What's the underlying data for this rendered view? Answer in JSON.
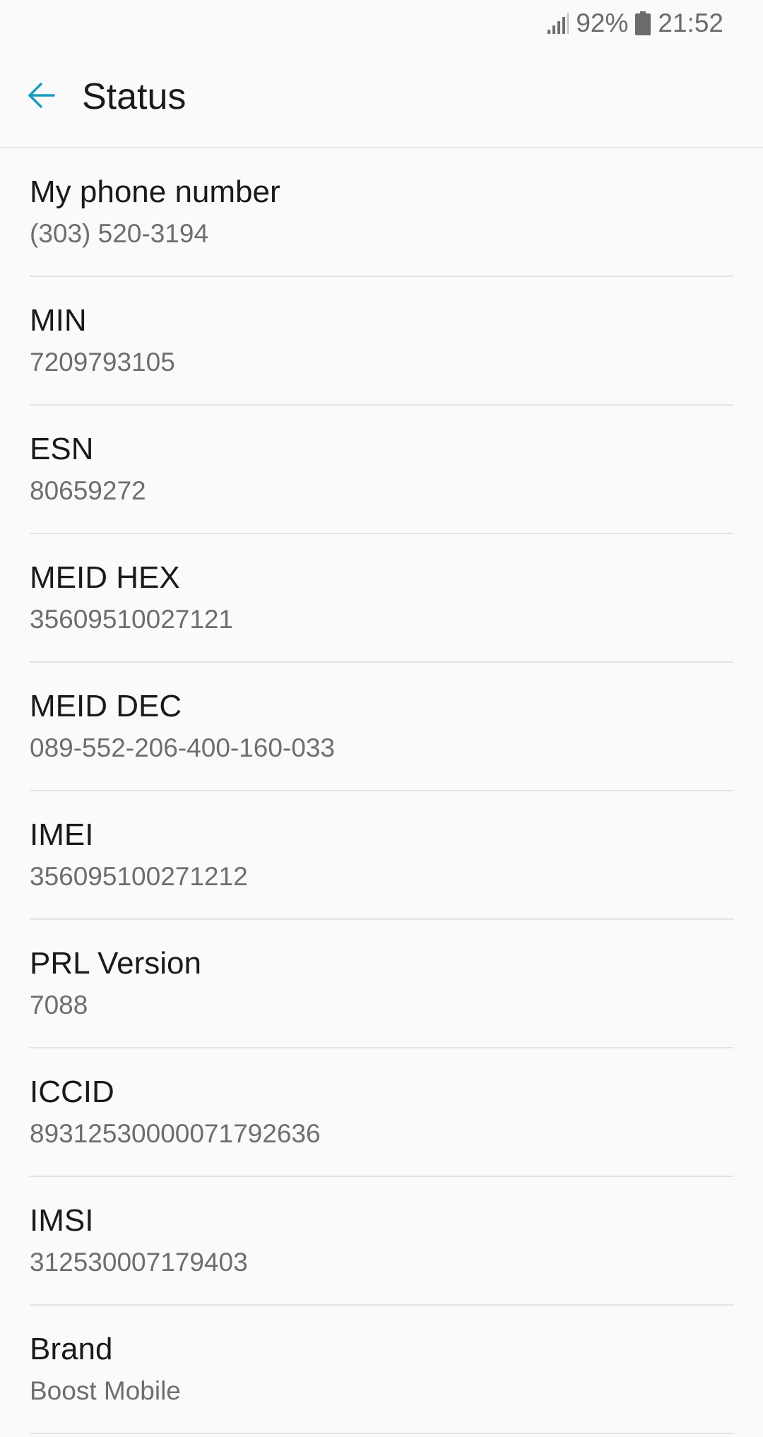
{
  "status_bar": {
    "battery_percent": "92%",
    "time": "21:52",
    "signal_icon": "signal-icon",
    "battery_icon": "battery-icon"
  },
  "app_bar": {
    "title": "Status",
    "back_icon": "arrow-back-icon",
    "accent_color": "#1a9cbd"
  },
  "items": [
    {
      "label": "My phone number",
      "value": "(303) 520-3194"
    },
    {
      "label": "MIN",
      "value": "7209793105"
    },
    {
      "label": "ESN",
      "value": "80659272"
    },
    {
      "label": "MEID HEX",
      "value": "35609510027121"
    },
    {
      "label": "MEID DEC",
      "value": "089-552-206-400-160-033"
    },
    {
      "label": "IMEI",
      "value": "356095100271212"
    },
    {
      "label": "PRL Version",
      "value": "7088"
    },
    {
      "label": "ICCID",
      "value": "89312530000071792636"
    },
    {
      "label": "IMSI",
      "value": "312530007179403"
    },
    {
      "label": "Brand",
      "value": "Boost Mobile"
    }
  ]
}
